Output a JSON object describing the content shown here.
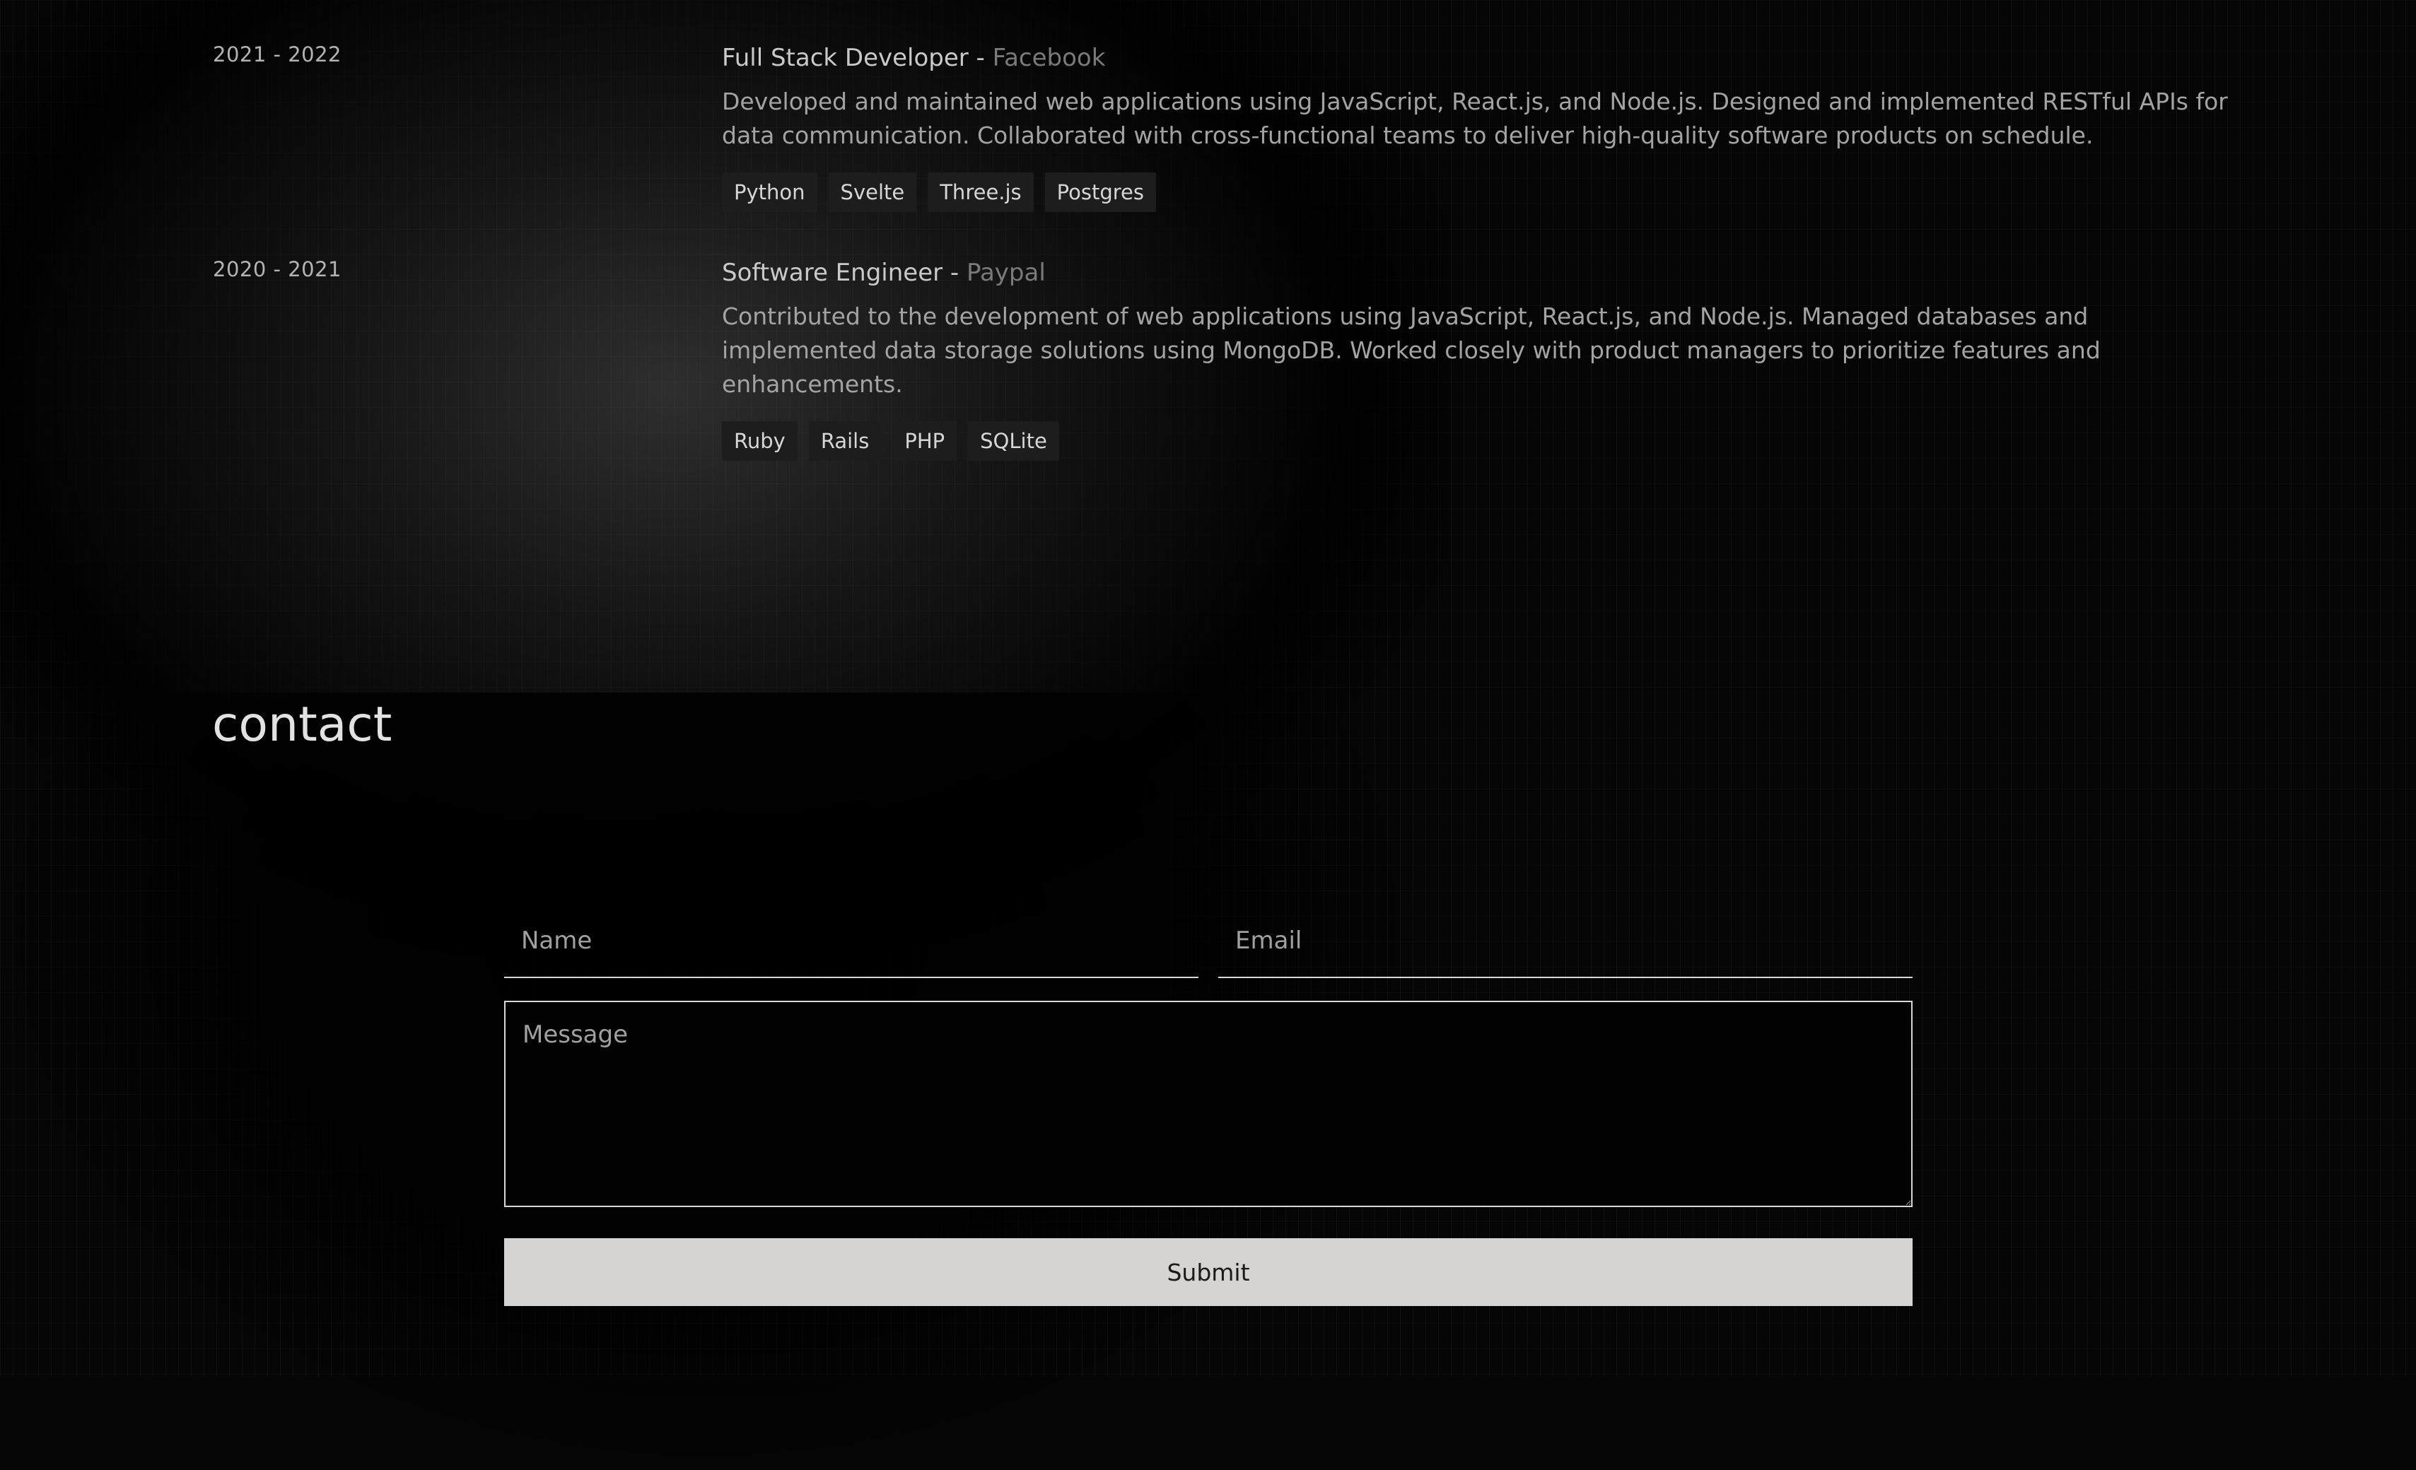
{
  "experience": [
    {
      "period": "2021 - 2022",
      "role": "Full Stack Developer",
      "separator": " - ",
      "company": "Facebook",
      "description": "Developed and maintained web applications using JavaScript, React.js, and Node.js. Designed and implemented RESTful APIs for data communication. Collaborated with cross-functional teams to deliver high-quality software products on schedule.",
      "tags": [
        "Python",
        "Svelte",
        "Three.js",
        "Postgres"
      ]
    },
    {
      "period": "2020 - 2021",
      "role": "Software Engineer",
      "separator": " - ",
      "company": "Paypal",
      "description": "Contributed to the development of web applications using JavaScript, React.js, and Node.js. Managed databases and implemented data storage solutions using MongoDB. Worked closely with product managers to prioritize features and enhancements.",
      "tags": [
        "Ruby",
        "Rails",
        "PHP",
        "SQLite"
      ]
    }
  ],
  "contact": {
    "title": "contact",
    "name_placeholder": "Name",
    "email_placeholder": "Email",
    "message_placeholder": "Message",
    "submit_label": "Submit"
  }
}
